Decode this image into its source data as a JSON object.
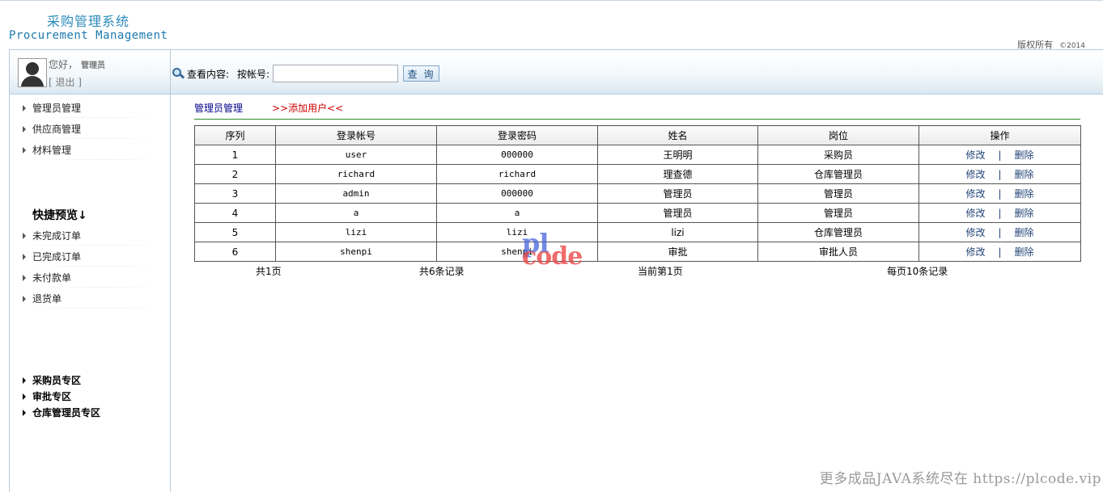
{
  "header": {
    "title_cn": "采购管理系统",
    "title_en": "Procurement Management",
    "copyright": "版权所有",
    "copyright_year": "©2014"
  },
  "user": {
    "greeting": "您好，",
    "role": "管理员",
    "logout": "[ 退出 ]"
  },
  "search": {
    "label": "查看内容:",
    "by_label": "按帐号:",
    "value": "",
    "button": "查 询"
  },
  "sidebar": {
    "items": [
      {
        "label": "管理员管理"
      },
      {
        "label": "供应商管理"
      },
      {
        "label": "材料管理"
      }
    ],
    "quick_title": "快捷预览↓",
    "quick_items": [
      {
        "label": "未完成订单"
      },
      {
        "label": "已完成订单"
      },
      {
        "label": "未付款单"
      },
      {
        "label": "退货单"
      }
    ],
    "zones": [
      {
        "label": "采购员专区"
      },
      {
        "label": "审批专区"
      },
      {
        "label": "仓库管理员专区"
      }
    ]
  },
  "main": {
    "breadcrumb_title": "管理员管理",
    "add_link": ">>添加用户<<",
    "table": {
      "headers": [
        "序列",
        "登录帐号",
        "登录密码",
        "姓名",
        "岗位",
        "操作"
      ],
      "rows": [
        {
          "id": "1",
          "account": "user",
          "password": "000000",
          "name": "王明明",
          "post": "采购员"
        },
        {
          "id": "2",
          "account": "richard",
          "password": "richard",
          "name": "理查德",
          "post": "仓库管理员"
        },
        {
          "id": "3",
          "account": "admin",
          "password": "000000",
          "name": "管理员",
          "post": "管理员"
        },
        {
          "id": "4",
          "account": "a",
          "password": "a",
          "name": "管理员",
          "post": "管理员"
        },
        {
          "id": "5",
          "account": "lizi",
          "password": "lizi",
          "name": "lizi",
          "post": "仓库管理员"
        },
        {
          "id": "6",
          "account": "shenpi",
          "password": "shenpi",
          "name": "审批",
          "post": "审批人员"
        }
      ],
      "edit_label": "修改",
      "separator": "|",
      "delete_label": "删除"
    },
    "pager": {
      "total_pages": "共1页",
      "total_records": "共6条记录",
      "current_page": "当前第1页",
      "page_size": "每页10条记录"
    }
  },
  "watermark": {
    "top": "pl",
    "bottom": "code"
  },
  "site_banner": "更多成品JAVA系统尽在 https://plcode.vip"
}
